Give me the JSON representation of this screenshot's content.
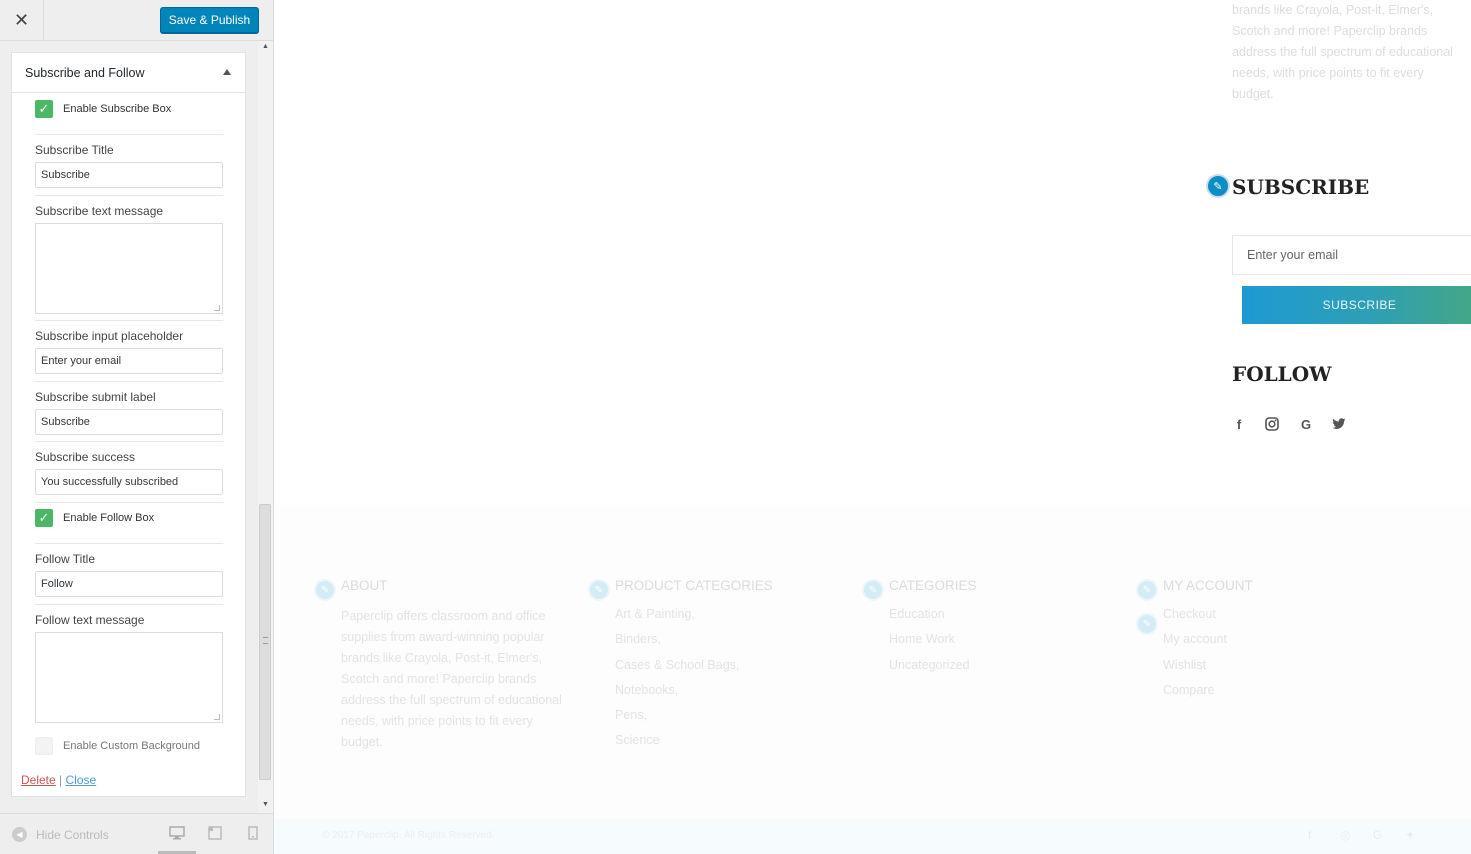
{
  "topbar": {
    "close_glyph": "✕",
    "publish_label": "Save & Publish"
  },
  "section": {
    "title": "Subscribe and Follow"
  },
  "controls": {
    "enable_subscribe_label": "Enable Subscribe Box",
    "subscribe_title_label": "Subscribe Title",
    "subscribe_title_value": "Subscribe",
    "subscribe_text_label": "Subscribe text message",
    "subscribe_placeholder_label": "Subscribe input placeholder",
    "subscribe_placeholder_value": "Enter your email",
    "subscribe_submit_label": "Subscribe submit label",
    "subscribe_submit_value": "Subscribe",
    "subscribe_success_label": "Subscribe success",
    "subscribe_success_value": "You successfully subscribed",
    "enable_follow_label": "Enable Follow Box",
    "follow_title_label": "Follow Title",
    "follow_title_value": "Follow",
    "follow_text_label": "Follow text message",
    "enable_custom_bg_label": "Enable Custom Background"
  },
  "links": {
    "delete": "Delete",
    "separator": "|",
    "close": "Close"
  },
  "footer_controls": {
    "hide_label": "Hide Controls"
  },
  "preview": {
    "about_top_text": "brands like Crayola, Post-it, Elmer's, Scotch and more! Paperclip brands address the full spectrum of educational needs, with price points to fit every budget.",
    "subscribe_title": "SUBSCRIBE",
    "email_placeholder": "Enter your email",
    "subscribe_button": "SUBSCRIBE",
    "follow_title": "FOLLOW",
    "social_icons": [
      "facebook-icon",
      "instagram-icon",
      "google-icon",
      "twitter-icon"
    ],
    "footer": {
      "about_title": "ABOUT",
      "about_text": "Paperclip offers classroom and office supplies from award-winning popular brands like Crayola, Post-it, Elmer's, Scotch and more! Paperclip brands address the full spectrum of educational needs, with price points to fit every budget.",
      "product_categories_title": "PRODUCT CATEGORIES",
      "product_categories": [
        "Art & Painting,",
        "Binders,",
        "Cases & School Bags,",
        "Notebooks,",
        "Pens,",
        "Science"
      ],
      "categories_title": "CATEGORIES",
      "categories": [
        "Education",
        "Home Work",
        "Uncategorized"
      ],
      "my_account_title": "MY ACCOUNT",
      "my_account": [
        "Checkout",
        "My account",
        "Wishlist",
        "Compare"
      ]
    },
    "copyright": "© 2017 Paperclip. All Rights Reserved."
  },
  "colors": {
    "primary_button": "#0085ba",
    "checkbox_green": "#4ab866",
    "pencil_blue": "#0a8ec4"
  }
}
